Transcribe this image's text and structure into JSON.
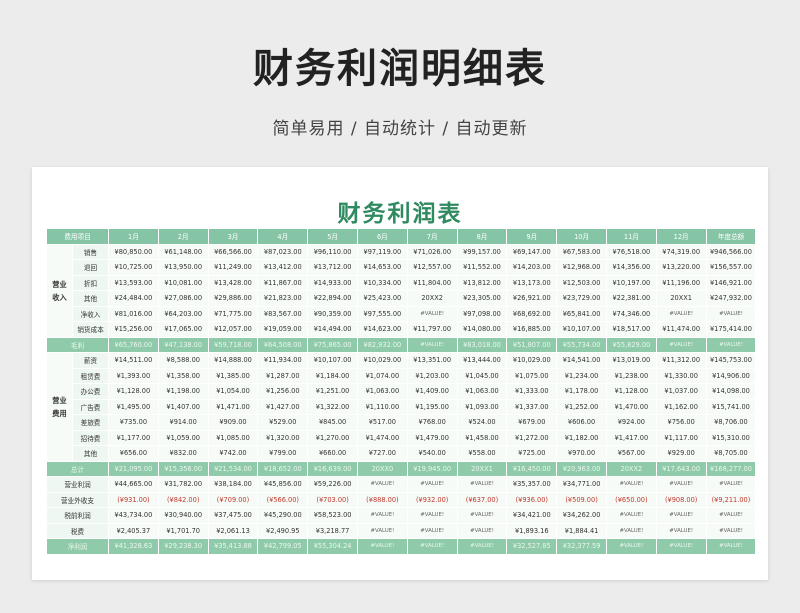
{
  "title": "财务利润明细表",
  "subtitle": "简单易用 / 自动统计 / 自动更新",
  "sheet_title": "财务利润表",
  "header": [
    "费用项目",
    "1月",
    "2月",
    "3月",
    "4月",
    "5月",
    "6月",
    "7月",
    "8月",
    "9月",
    "10月",
    "11月",
    "12月",
    "年度总额"
  ],
  "income": {
    "group": "营业\n收入",
    "rows": [
      {
        "label": "销售",
        "values": [
          "¥80,850.00",
          "¥61,148.00",
          "¥66,566.00",
          "¥87,023.00",
          "¥96,110.00",
          "¥97,119.00",
          "¥71,026.00",
          "¥99,157.00",
          "¥69,147.00",
          "¥67,583.00",
          "¥76,518.00",
          "¥74,319.00",
          "¥946,566.00"
        ]
      },
      {
        "label": "退回",
        "values": [
          "¥10,725.00",
          "¥13,950.00",
          "¥11,249.00",
          "¥13,412.00",
          "¥13,712.00",
          "¥14,653.00",
          "¥12,557.00",
          "¥11,552.00",
          "¥14,203.00",
          "¥12,968.00",
          "¥14,356.00",
          "¥13,220.00",
          "¥156,557.00"
        ]
      },
      {
        "label": "折扣",
        "values": [
          "¥13,593.00",
          "¥10,081.00",
          "¥13,428.00",
          "¥11,867.00",
          "¥14,933.00",
          "¥10,334.00",
          "¥11,804.00",
          "¥13,812.00",
          "¥13,173.00",
          "¥12,503.00",
          "¥10,197.00",
          "¥11,196.00",
          "¥146,921.00"
        ]
      },
      {
        "label": "其他",
        "values": [
          "¥24,484.00",
          "¥27,086.00",
          "¥29,886.00",
          "¥21,823.00",
          "¥22,894.00",
          "¥25,423.00",
          "20XX2",
          "¥23,305.00",
          "¥26,921.00",
          "¥23,729.00",
          "¥22,381.00",
          "20XX1",
          "¥247,932.00"
        ]
      },
      {
        "label": "净收入",
        "values": [
          "¥81,016.00",
          "¥64,203.00",
          "¥71,775.00",
          "¥83,567.00",
          "¥90,359.00",
          "¥97,555.00",
          "#VALUE!",
          "¥97,098.00",
          "¥68,692.00",
          "¥65,841.00",
          "¥74,346.00",
          "#VALUE!",
          "#VALUE!"
        ]
      },
      {
        "label": "销货成本",
        "values": [
          "¥15,256.00",
          "¥17,065.00",
          "¥12,057.00",
          "¥19,059.00",
          "¥14,494.00",
          "¥14,623.00",
          "¥11,797.00",
          "¥14,080.00",
          "¥16,885.00",
          "¥10,107.00",
          "¥18,517.00",
          "¥11,474.00",
          "¥175,414.00"
        ]
      }
    ]
  },
  "gross": {
    "label": "毛利",
    "values": [
      "¥65,760.00",
      "¥47,138.00",
      "¥59,718.00",
      "¥64,508.00",
      "¥75,865.00",
      "¥82,932.00",
      "#VALUE!",
      "¥83,018.00",
      "¥51,807.00",
      "¥55,734.00",
      "¥55,829.00",
      "#VALUE!",
      "#VALUE!"
    ]
  },
  "expense": {
    "group": "营业\n费用",
    "rows": [
      {
        "label": "薪资",
        "values": [
          "¥14,511.00",
          "¥8,588.00",
          "¥14,888.00",
          "¥11,934.00",
          "¥10,107.00",
          "¥10,029.00",
          "¥13,351.00",
          "¥13,444.00",
          "¥10,029.00",
          "¥14,541.00",
          "¥13,019.00",
          "¥11,312.00",
          "¥145,753.00"
        ]
      },
      {
        "label": "租赁费",
        "values": [
          "¥1,393.00",
          "¥1,358.00",
          "¥1,385.00",
          "¥1,287.00",
          "¥1,184.00",
          "¥1,074.00",
          "¥1,203.00",
          "¥1,045.00",
          "¥1,075.00",
          "¥1,234.00",
          "¥1,238.00",
          "¥1,330.00",
          "¥14,906.00"
        ]
      },
      {
        "label": "办公费",
        "values": [
          "¥1,128.00",
          "¥1,198.00",
          "¥1,054.00",
          "¥1,256.00",
          "¥1,251.00",
          "¥1,063.00",
          "¥1,409.00",
          "¥1,063.00",
          "¥1,333.00",
          "¥1,178.00",
          "¥1,128.00",
          "¥1,037.00",
          "¥14,098.00"
        ]
      },
      {
        "label": "广告费",
        "values": [
          "¥1,495.00",
          "¥1,407.00",
          "¥1,471.00",
          "¥1,427.00",
          "¥1,322.00",
          "¥1,110.00",
          "¥1,195.00",
          "¥1,093.00",
          "¥1,337.00",
          "¥1,252.00",
          "¥1,470.00",
          "¥1,162.00",
          "¥15,741.00"
        ]
      },
      {
        "label": "差旅费",
        "values": [
          "¥735.00",
          "¥914.00",
          "¥909.00",
          "¥529.00",
          "¥845.00",
          "¥517.00",
          "¥768.00",
          "¥524.00",
          "¥679.00",
          "¥606.00",
          "¥924.00",
          "¥756.00",
          "¥8,706.00"
        ]
      },
      {
        "label": "招待费",
        "values": [
          "¥1,177.00",
          "¥1,059.00",
          "¥1,085.00",
          "¥1,320.00",
          "¥1,270.00",
          "¥1,474.00",
          "¥1,479.00",
          "¥1,458.00",
          "¥1,272.00",
          "¥1,182.00",
          "¥1,417.00",
          "¥1,117.00",
          "¥15,310.00"
        ]
      },
      {
        "label": "其他",
        "values": [
          "¥656.00",
          "¥832.00",
          "¥742.00",
          "¥799.00",
          "¥660.00",
          "¥727.00",
          "¥540.00",
          "¥558.00",
          "¥725.00",
          "¥970.00",
          "¥567.00",
          "¥929.00",
          "¥8,705.00"
        ]
      }
    ]
  },
  "total": {
    "label": "总计",
    "values": [
      "¥21,095.00",
      "¥15,356.00",
      "¥21,534.00",
      "¥18,652.00",
      "¥16,639.00",
      "20XX0",
      "¥19,945.00",
      "20XX1",
      "¥16,450.00",
      "¥20,963.00",
      "20XX2",
      "¥17,643.00",
      "¥168,277.00"
    ]
  },
  "bottom": [
    {
      "label": "营业利润",
      "values": [
        "¥44,665.00",
        "¥31,782.00",
        "¥38,184.00",
        "¥45,856.00",
        "¥59,226.00",
        "#VALUE!",
        "#VALUE!",
        "#VALUE!",
        "¥35,357.00",
        "¥34,771.00",
        "#VALUE!",
        "#VALUE!",
        "#VALUE!"
      ]
    },
    {
      "label": "营业外收支",
      "neg": true,
      "values": [
        "(¥931.00)",
        "(¥842.00)",
        "(¥709.00)",
        "(¥566.00)",
        "(¥703.00)",
        "(¥888.00)",
        "(¥932.00)",
        "(¥637.00)",
        "(¥936.00)",
        "(¥509.00)",
        "(¥650.00)",
        "(¥908.00)",
        "(¥9,211.00)"
      ]
    },
    {
      "label": "税前利润",
      "values": [
        "¥43,734.00",
        "¥30,940.00",
        "¥37,475.00",
        "¥45,290.00",
        "¥58,523.00",
        "#VALUE!",
        "#VALUE!",
        "#VALUE!",
        "¥34,421.00",
        "¥34,262.00",
        "#VALUE!",
        "#VALUE!",
        "#VALUE!"
      ]
    },
    {
      "label": "税费",
      "values": [
        "¥2,405.37",
        "¥1,701.70",
        "¥2,061.13",
        "¥2,490.95",
        "¥3,218.77",
        "#VALUE!",
        "#VALUE!",
        "#VALUE!",
        "¥1,893.16",
        "¥1,884.41",
        "#VALUE!",
        "#VALUE!",
        "#VALUE!"
      ]
    }
  ],
  "net": {
    "label": "净利润",
    "values": [
      "¥41,328.63",
      "¥29,238.30",
      "¥35,413.88",
      "¥42,799.05",
      "¥55,304.24",
      "#VALUE!",
      "#VALUE!",
      "#VALUE!",
      "¥32,527.85",
      "¥32,377.59",
      "#VALUE!",
      "#VALUE!",
      "#VALUE!"
    ]
  }
}
